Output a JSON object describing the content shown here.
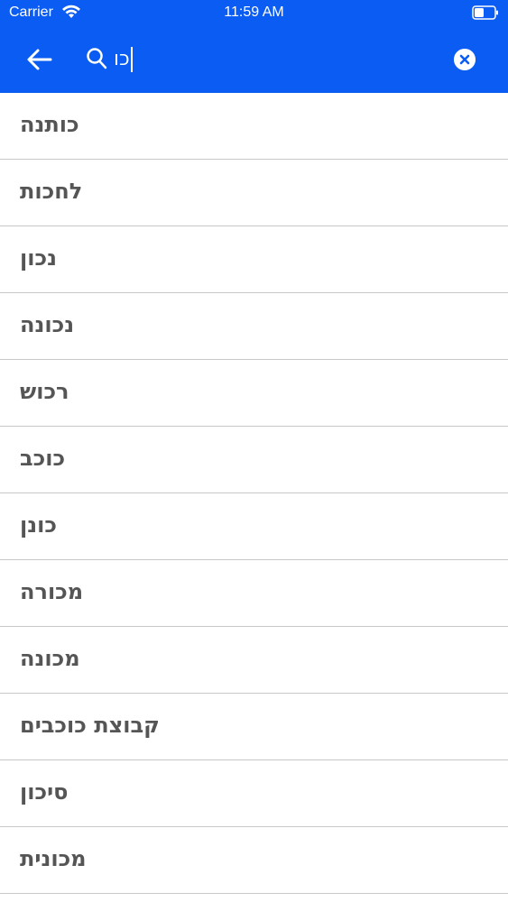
{
  "status_bar": {
    "carrier": "Carrier",
    "time": "11:59 AM"
  },
  "header": {
    "search": {
      "value": "כו",
      "placeholder": ""
    },
    "accent_color": "#0a5cf2"
  },
  "results": [
    "כותנה",
    "לחכות",
    "נכון",
    "נכונה",
    "רכוש",
    "כוכב",
    "כונן",
    "מכורה",
    "מכונה",
    "קבוצת כוכבים",
    "סיכון",
    "מכונית"
  ]
}
